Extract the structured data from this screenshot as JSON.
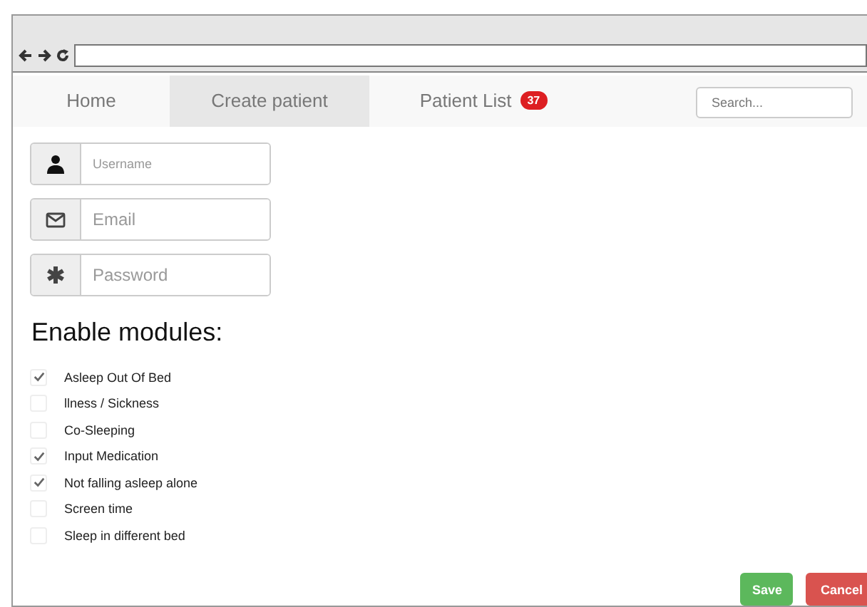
{
  "nav": {
    "items": [
      {
        "label": "Home",
        "selected": false
      },
      {
        "label": "Create patient",
        "selected": true
      },
      {
        "label": "Patient List",
        "selected": false,
        "badge": "37"
      }
    ],
    "search": {
      "placeholder": "Search..."
    }
  },
  "fields": [
    {
      "kind": "user",
      "placeholder": "Username"
    },
    {
      "kind": "email",
      "placeholder": "Email"
    },
    {
      "kind": "password",
      "placeholder": "Password"
    }
  ],
  "modules": {
    "heading": "Enable modules:",
    "items": [
      {
        "label": "Asleep Out Of Bed",
        "checked": true
      },
      {
        "label": "llness / Sickness",
        "checked": false
      },
      {
        "label": "Co-Sleeping",
        "checked": false
      },
      {
        "label": "Input Medication",
        "checked": true
      },
      {
        "label": "Not falling asleep alone",
        "checked": true
      },
      {
        "label": "Screen time",
        "checked": false
      },
      {
        "label": "Sleep in different bed",
        "checked": false
      }
    ]
  },
  "buttons": [
    {
      "kind": "save",
      "label": "Save"
    },
    {
      "kind": "cancel",
      "label": "Cancel"
    }
  ]
}
